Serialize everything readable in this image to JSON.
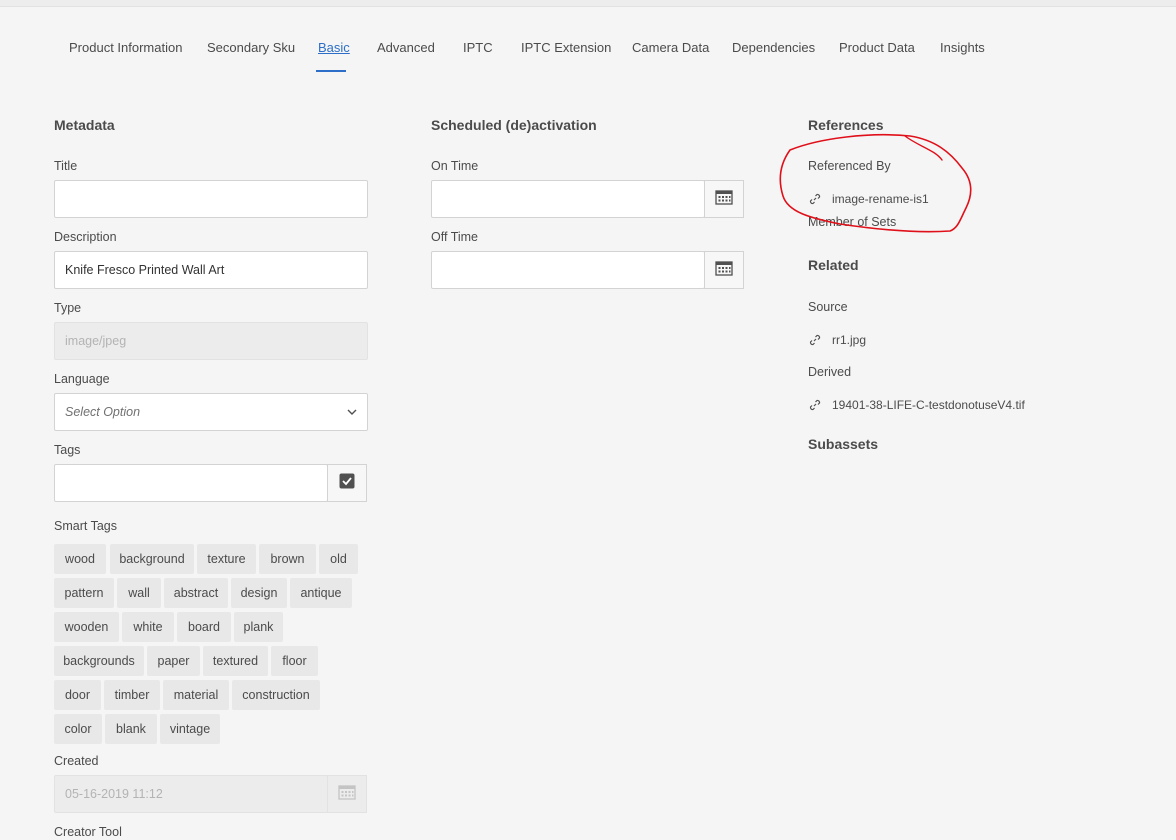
{
  "tabs": [
    {
      "label": "Product Information",
      "active": false
    },
    {
      "label": "Secondary Sku",
      "active": false
    },
    {
      "label": "Basic",
      "active": true
    },
    {
      "label": "Advanced",
      "active": false
    },
    {
      "label": "IPTC",
      "active": false
    },
    {
      "label": "IPTC Extension",
      "active": false
    },
    {
      "label": "Camera Data",
      "active": false
    },
    {
      "label": "Dependencies",
      "active": false
    },
    {
      "label": "Product Data",
      "active": false
    },
    {
      "label": "Insights",
      "active": false
    }
  ],
  "metadata": {
    "heading": "Metadata",
    "title_label": "Title",
    "title_value": "",
    "description_label": "Description",
    "description_value": "Knife Fresco Printed Wall Art",
    "type_label": "Type",
    "type_value": "image/jpeg",
    "language_label": "Language",
    "language_value": "Select Option",
    "tags_label": "Tags",
    "tags_value": "",
    "smart_tags_label": "Smart Tags",
    "smart_tags": [
      [
        "wood",
        "background",
        "texture",
        "brown",
        "old"
      ],
      [
        "pattern",
        "wall",
        "abstract",
        "design",
        "antique"
      ],
      [
        "wooden",
        "white",
        "board",
        "plank"
      ],
      [
        "backgrounds",
        "paper",
        "textured",
        "floor"
      ],
      [
        "door",
        "timber",
        "material",
        "construction"
      ],
      [
        "color",
        "blank",
        "vintage"
      ]
    ],
    "created_label": "Created",
    "created_value": "05-16-2019 11:12",
    "creator_tool_label": "Creator Tool"
  },
  "schedule": {
    "heading": "Scheduled (de)activation",
    "on_time_label": "On Time",
    "on_time_value": "",
    "off_time_label": "Off Time",
    "off_time_value": ""
  },
  "references": {
    "heading": "References",
    "referenced_by_label": "Referenced By",
    "referenced_by_item": "image-rename-is1",
    "member_of_sets_label": "Member of Sets",
    "related_heading": "Related",
    "source_label": "Source",
    "source_item": "rr1.jpg",
    "derived_label": "Derived",
    "derived_item": "19401-38-LIFE-C-testdonotuseV4.tif",
    "subassets_heading": "Subassets"
  },
  "colors": {
    "accent": "#2d6fc8",
    "annotation": "#e0101a"
  },
  "icons": {
    "calendar": "calendar-icon",
    "checkbox": "checkbox-checked-icon",
    "link": "link-icon",
    "chevron": "chevron-down-icon"
  }
}
